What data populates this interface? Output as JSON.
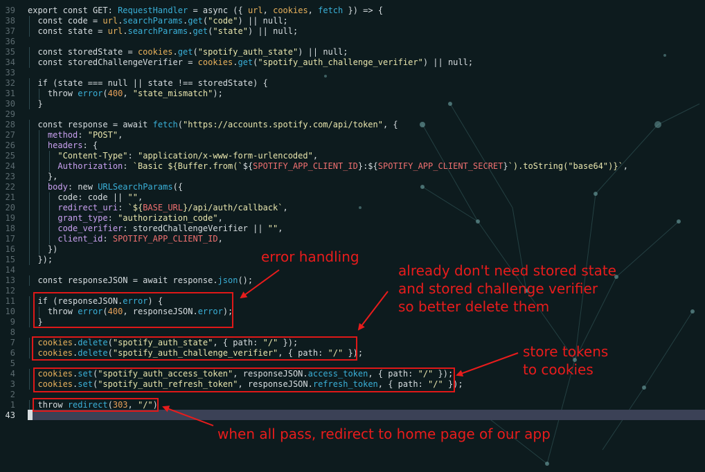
{
  "editor": {
    "current_line_number": "43",
    "lines": [
      {
        "n": "39",
        "code": "export const GET: RequestHandler = async ({ url, cookies, fetch }) => {"
      },
      {
        "n": "38",
        "code": "  const code = url.searchParams.get(\"code\") || null;"
      },
      {
        "n": "37",
        "code": "  const state = url.searchParams.get(\"state\") || null;"
      },
      {
        "n": "36",
        "code": ""
      },
      {
        "n": "35",
        "code": "  const storedState = cookies.get(\"spotify_auth_state\") || null;"
      },
      {
        "n": "34",
        "code": "  const storedChallengeVerifier = cookies.get(\"spotify_auth_challenge_verifier\") || null;"
      },
      {
        "n": "33",
        "code": ""
      },
      {
        "n": "32",
        "code": "  if (state === null || state !== storedState) {"
      },
      {
        "n": "31",
        "code": "    throw error(400, \"state_mismatch\");"
      },
      {
        "n": "30",
        "code": "  }"
      },
      {
        "n": "29",
        "code": ""
      },
      {
        "n": "28",
        "code": "  const response = await fetch(\"https://accounts.spotify.com/api/token\", {"
      },
      {
        "n": "27",
        "code": "    method: \"POST\","
      },
      {
        "n": "26",
        "code": "    headers: {"
      },
      {
        "n": "25",
        "code": "      \"Content-Type\": \"application/x-www-form-urlencoded\","
      },
      {
        "n": "24",
        "code": "      Authorization: `Basic ${Buffer.from(`${SPOTIFY_APP_CLIENT_ID}:${SPOTIFY_APP_CLIENT_SECRET}`).toString(\"base64\")}`,"
      },
      {
        "n": "23",
        "code": "    },"
      },
      {
        "n": "22",
        "code": "    body: new URLSearchParams({"
      },
      {
        "n": "21",
        "code": "      code: code || \"\","
      },
      {
        "n": "20",
        "code": "      redirect_uri: `${BASE_URL}/api/auth/callback`,"
      },
      {
        "n": "19",
        "code": "      grant_type: \"authorization_code\","
      },
      {
        "n": "18",
        "code": "      code_verifier: storedChallengeVerifier || \"\","
      },
      {
        "n": "17",
        "code": "      client_id: SPOTIFY_APP_CLIENT_ID,"
      },
      {
        "n": "16",
        "code": "    })"
      },
      {
        "n": "15",
        "code": "  });"
      },
      {
        "n": "14",
        "code": ""
      },
      {
        "n": "13",
        "code": "  const responseJSON = await response.json();"
      },
      {
        "n": "12",
        "code": ""
      },
      {
        "n": "11",
        "code": "  if (responseJSON.error) {"
      },
      {
        "n": "10",
        "code": "    throw error(400, responseJSON.error);"
      },
      {
        "n": "9",
        "code": "  }"
      },
      {
        "n": "8",
        "code": ""
      },
      {
        "n": "7",
        "code": "  cookies.delete(\"spotify_auth_state\", { path: \"/\" });"
      },
      {
        "n": "6",
        "code": "  cookies.delete(\"spotify_auth_challenge_verifier\", { path: \"/\" });"
      },
      {
        "n": "5",
        "code": ""
      },
      {
        "n": "4",
        "code": "  cookies.set(\"spotify_auth_access_token\", responseJSON.access_token, { path: \"/\" });"
      },
      {
        "n": "3",
        "code": "  cookies.set(\"spotify_auth_refresh_token\", responseJSON.refresh_token, { path: \"/\" });"
      },
      {
        "n": "2",
        "code": ""
      },
      {
        "n": "1",
        "code": "  throw redirect(303, \"/\")"
      },
      {
        "n": "43",
        "code": "}"
      }
    ]
  },
  "annotations": {
    "error_handling": "error handling",
    "delete_note_1": "already don't need stored state",
    "delete_note_2": "and stored challenge verifier",
    "delete_note_3": "so better delete them",
    "store_note_1": "store tokens",
    "store_note_2": "to cookies",
    "redirect_note": "when all pass, redirect to home page of our app"
  },
  "colors": {
    "annotation": "#e81c1c",
    "background": "#0d1b1e",
    "cursor_line": "#3b4156"
  }
}
